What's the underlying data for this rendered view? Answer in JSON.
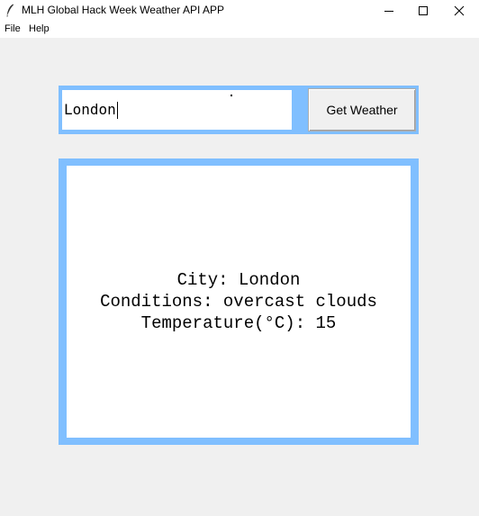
{
  "window": {
    "title": "MLH Global Hack Week Weather API APP",
    "icon": "feather-icon"
  },
  "menu": {
    "file": "File",
    "help": "Help"
  },
  "search": {
    "city_value": "London",
    "button_label": "Get Weather"
  },
  "result": {
    "city_line": "City: London",
    "conditions_line": "Conditions: overcast clouds",
    "temperature_line": "Temperature(°C): 15"
  },
  "colors": {
    "frame_accent": "#80bfff",
    "background": "#f0f0f0"
  }
}
